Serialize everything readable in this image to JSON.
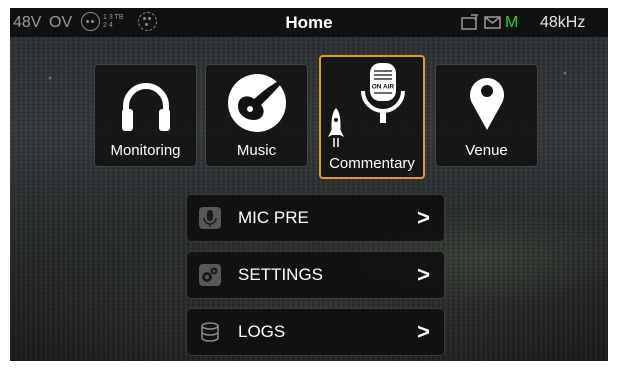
{
  "status_bar": {
    "phantom": "48V",
    "overload": "OV",
    "pins_top": "1 3 TB",
    "pins_bottom": "2 4",
    "title": "Home",
    "connection_indicator": "M",
    "sample_rate": "48kHz",
    "icons": [
      "xlr-connector-icon",
      "xlr-connector-small-icon",
      "card-icon",
      "mail-icon"
    ],
    "colors": {
      "indicator_green": "#2ecc40",
      "muted_text": "#9a9a9a"
    }
  },
  "tiles": [
    {
      "label": "Monitoring",
      "icon": "headphones-icon",
      "selected": false
    },
    {
      "label": "Music",
      "icon": "guitar-icon",
      "selected": false
    },
    {
      "label": "Commentary",
      "icon": "on-air-microphone-icon",
      "badge": "ON AIR",
      "selected": true
    },
    {
      "label": "Venue",
      "icon": "location-pin-icon",
      "selected": false
    }
  ],
  "selection_color": "#e39a25",
  "menu": [
    {
      "label": "MIC PRE",
      "icon": "microphone-icon",
      "arrow": ">"
    },
    {
      "label": "SETTINGS",
      "icon": "gears-icon",
      "arrow": ">"
    },
    {
      "label": "LOGS",
      "icon": "database-icon",
      "arrow": ">"
    }
  ]
}
